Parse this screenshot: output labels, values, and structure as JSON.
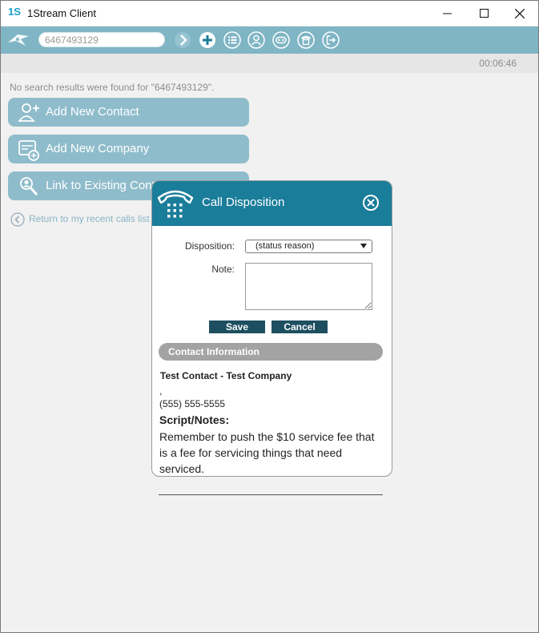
{
  "window": {
    "logo_text": "1S",
    "title": "1Stream Client",
    "controls": [
      "—",
      "☐",
      "✕"
    ]
  },
  "toolbar": {
    "search_value": "6467493129",
    "icons": [
      "logo-bird-icon",
      "forward-icon",
      "add-icon",
      "list-icon",
      "user-icon",
      "agent-status-icon",
      "phone-icon",
      "logout-icon"
    ],
    "accent": "#7fb5c5"
  },
  "status": {
    "timer": "00:06:46"
  },
  "search": {
    "no_results": "No search results were found for \"6467493129\"."
  },
  "actions": [
    {
      "label": "Add New Contact",
      "icon": "add-contact-icon"
    },
    {
      "label": "Add New Company",
      "icon": "add-company-icon"
    },
    {
      "label": "Link to Existing Contact",
      "icon": "link-contact-icon"
    }
  ],
  "return_link": "Return to my recent calls list",
  "modal": {
    "title": "Call Disposition",
    "header_color": "#1a7d9a",
    "disposition_label": "Disposition:",
    "disposition_value": "(status reason)",
    "note_label": "Note:",
    "save": "Save",
    "cancel": "Cancel",
    "section_title": "Contact Information",
    "contact_name": "Test Contact - Test Company",
    "address_line": ",",
    "phone": "(555) 555-5555",
    "script_heading": "Script/Notes:",
    "script_text": "Remember to push the $10 service fee that is a fee for servicing things that need serviced."
  }
}
